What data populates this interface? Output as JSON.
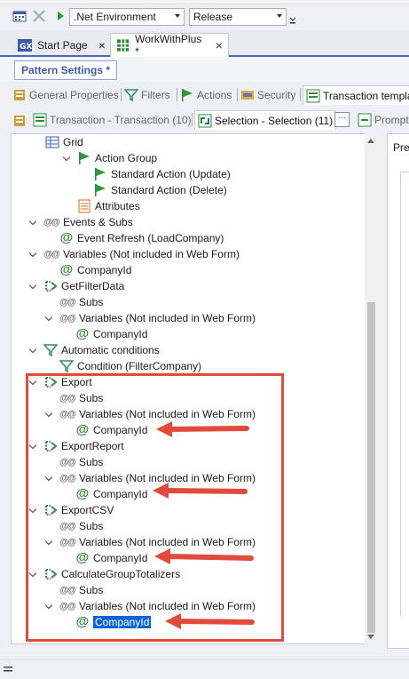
{
  "toolbar": {
    "environment": ".Net Environment",
    "configuration": "Release"
  },
  "doc_tabs": [
    {
      "label": "Start Page",
      "icon": "gx-icon"
    },
    {
      "label": "WorkWithPlus *",
      "icon": "grid-icon"
    }
  ],
  "pattern_settings_label": "Pattern Settings *",
  "property_tabs": [
    {
      "label": "General Properties",
      "icon": "properties-icon"
    },
    {
      "label": "Filters",
      "icon": "filter-icon"
    },
    {
      "label": "Actions",
      "icon": "flag-icon"
    },
    {
      "label": "Security",
      "icon": "security-icon"
    },
    {
      "label": "Transaction templa",
      "icon": "transaction-icon"
    }
  ],
  "sub_tabs": [
    {
      "label": "Transaction - Transaction (10)"
    },
    {
      "label": "Selection - Selection (11)"
    },
    {
      "label": "Prompt"
    }
  ],
  "preview_label": "Pre",
  "tree": [
    {
      "label": "Grid",
      "icon": "grid-icon"
    },
    {
      "label": "Action Group",
      "icon": "flag-icon"
    },
    {
      "label": "Standard Action (Update)",
      "icon": "flag-icon"
    },
    {
      "label": "Standard Action (Delete)",
      "icon": "flag-icon"
    },
    {
      "label": "Attributes",
      "icon": "attributes-icon"
    },
    {
      "label": "Events & Subs",
      "icon": "atat"
    },
    {
      "label": "Event Refresh (LoadCompany)",
      "icon": "at"
    },
    {
      "label": "Variables (Not included in Web Form)",
      "icon": "atat"
    },
    {
      "label": "CompanyId",
      "icon": "at"
    },
    {
      "label": "GetFilterData",
      "icon": "procedure-icon"
    },
    {
      "label": "Subs",
      "icon": "atat"
    },
    {
      "label": "Variables (Not included in Web Form)",
      "icon": "atat"
    },
    {
      "label": "CompanyId",
      "icon": "at"
    },
    {
      "label": "Automatic conditions",
      "icon": "filter-icon"
    },
    {
      "label": "Condition (FilterCompany)",
      "icon": "filter-icon"
    },
    {
      "label": "Export",
      "icon": "procedure-icon"
    },
    {
      "label": "Subs",
      "icon": "atat"
    },
    {
      "label": "Variables (Not included in Web Form)",
      "icon": "atat"
    },
    {
      "label": "CompanyId",
      "icon": "at"
    },
    {
      "label": "ExportReport",
      "icon": "procedure-icon"
    },
    {
      "label": "Subs",
      "icon": "atat"
    },
    {
      "label": "Variables (Not included in Web Form)",
      "icon": "atat"
    },
    {
      "label": "CompanyId",
      "icon": "at"
    },
    {
      "label": "ExportCSV",
      "icon": "procedure-icon"
    },
    {
      "label": "Subs",
      "icon": "atat"
    },
    {
      "label": "Variables (Not included in Web Form)",
      "icon": "atat"
    },
    {
      "label": "CompanyId",
      "icon": "at"
    },
    {
      "label": "CalculateGroupTotalizers",
      "icon": "procedure-icon"
    },
    {
      "label": "Subs",
      "icon": "atat"
    },
    {
      "label": "Variables (Not included in Web Form)",
      "icon": "atat"
    },
    {
      "label": "CompanyId",
      "icon": "at"
    }
  ],
  "colors": {
    "annotation": "#e24a3b",
    "selection": "#0a64d6",
    "accent": "#4a69bd"
  }
}
